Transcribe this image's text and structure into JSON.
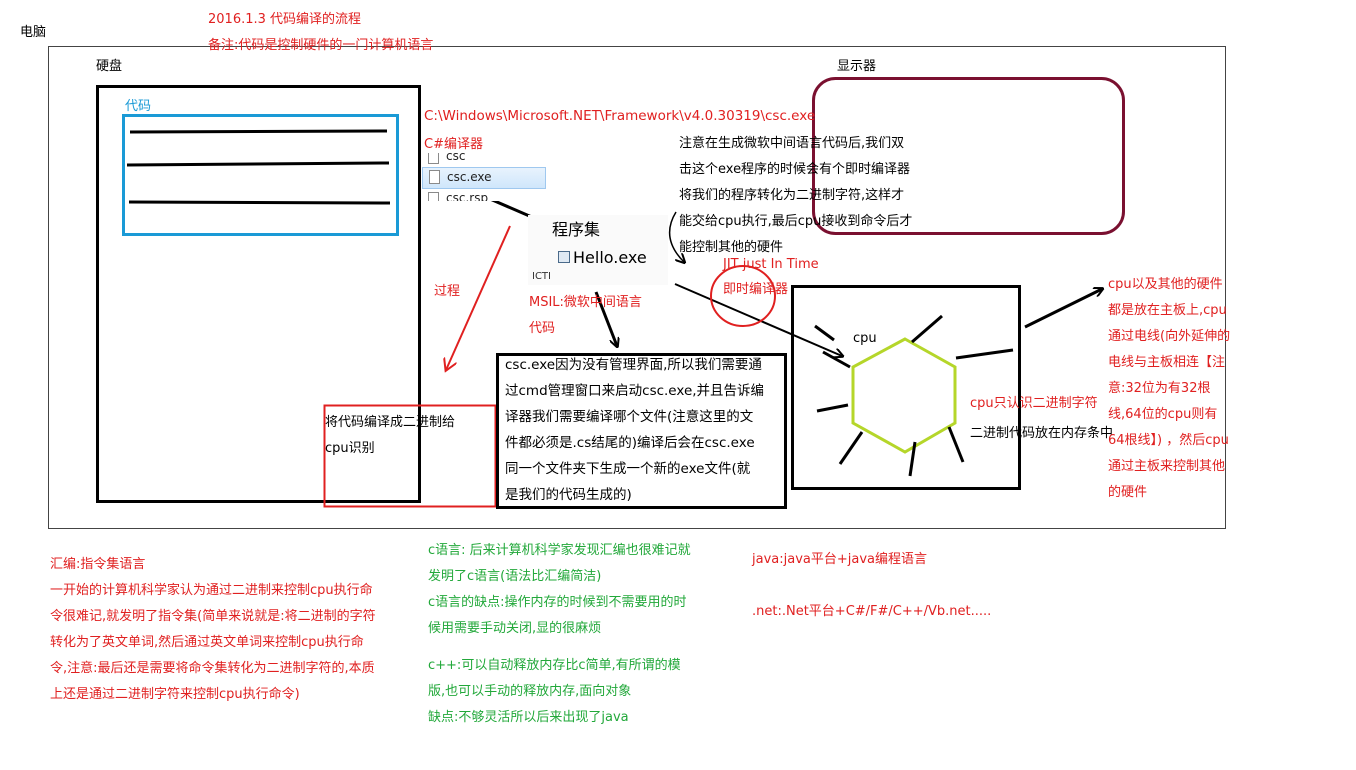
{
  "header": {
    "title": "2016.1.3   代码编译的流程",
    "note": "备注:代码是控制硬件的一门计算机语言"
  },
  "labels": {
    "computer": "电脑",
    "harddisk": "硬盘",
    "code": "代码",
    "monitor": "显示器",
    "csc_path": "C:\\Windows\\Microsoft.NET\\Framework\\v4.0.30319\\csc.exe",
    "csharp_compiler": "C#编译器",
    "process": "过程",
    "msil": [
      "MSIL:微软中间语言",
      "代码"
    ],
    "jit": [
      "JIT  just In Time",
      "即时编译器"
    ],
    "cpu": "cpu",
    "cpu_binary": "cpu只认识二进制字符",
    "binary_in_memory": "二进制代码放在内存条中"
  },
  "explorer": {
    "items": [
      "csc",
      "csc.exe",
      "csc.rsp"
    ],
    "selected": "csc.exe"
  },
  "assembly": {
    "title": "程序集",
    "file": "Hello.exe",
    "sub": "ICTI"
  },
  "notes": {
    "jit_note": [
      "注意在生成微软中间语言代码后,我们双",
      "击这个exe程序的时候会有个即时编译器",
      "将我们的程序转化为二进制字符,这样才",
      "能交给cpu执行,最后cpu接收到命令后才",
      "能控制其他的硬件"
    ],
    "compile_to_binary": [
      "将代码编译成二进制给",
      "cpu识别"
    ],
    "csc_note": [
      "csc.exe因为没有管理界面,所以我们需要通",
      "过cmd管理窗口来启动csc.exe,并且告诉编",
      "译器我们需要编译哪个文件(注意这里的文",
      "件都必须是.cs结尾的)编译后会在csc.exe",
      "同一个文件夹下生成一个新的exe文件(就",
      "是我们的代码生成的)"
    ],
    "cpu_hardware": [
      "cpu以及其他的硬件",
      "都是放在主板上,cpu",
      "通过电线(向外延伸的",
      "电线与主板相连【注",
      "意:32位为有32根",
      "线,64位的cpu则有",
      "64根线】) ，然后cpu",
      "通过主板来控制其他",
      "的硬件"
    ]
  },
  "bottom": {
    "assembly_lang": [
      "汇编:指令集语言",
      "一开始的计算机科学家认为通过二进制来控制cpu执行命",
      "令很难记,就发明了指令集(简单来说就是:将二进制的字符",
      "转化为了英文单词,然后通过英文单词来控制cpu执行命",
      "令,注意:最后还是需要将命令集转化为二进制字符的,本质",
      "上还是通过二进制字符来控制cpu执行命令)"
    ],
    "c_lang": [
      "c语言: 后来计算机科学家发现汇编也很难记就",
      "发明了c语言(语法比汇编简洁)",
      "c语言的缺点:操作内存的时候到不需要用的时",
      "候用需要手动关闭,显的很麻烦"
    ],
    "cpp_lang": [
      "c++:可以自动释放内存比c简单,有所谓的模",
      "版,也可以手动的释放内存,面向对象",
      "缺点:不够灵活所以后来出现了java"
    ],
    "java": "java:java平台+java编程语言",
    "dotnet": ".net:.Net平台+C#/F#/C++/Vb.net....."
  },
  "colors": {
    "red": "#e02020",
    "green": "#22a83a",
    "blue": "#1a9ad6",
    "maroon": "#7a1030",
    "lime": "#b5d62a"
  }
}
